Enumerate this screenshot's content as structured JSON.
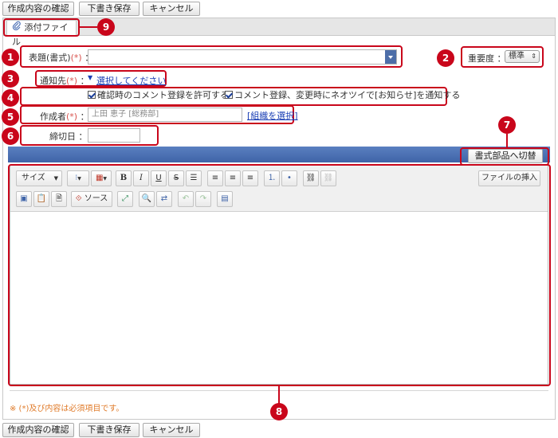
{
  "top_actions": {
    "confirm": "作成内容の確認",
    "draft": "下書き保存",
    "cancel": "キャンセル"
  },
  "tab": {
    "label": "添付ファイル"
  },
  "form": {
    "subject_label": "表題(書式)",
    "required_mark": "(*)",
    "colon": "：",
    "importance_label": "重要度",
    "importance_value": "標準",
    "notify_label": "通知先",
    "notify_link": "選択してください",
    "option1": "確認時のコメント登録を許可する",
    "option2": "コメント登録、変更時にネオツイで[お知らせ]を通知する",
    "author_label": "作成者",
    "author_value": "上田 恵子 [総務部]",
    "org_link": "[組織を選択]",
    "deadline_label": "締切日"
  },
  "format_switch": "書式部品へ切替",
  "editor": {
    "size_label": "サイズ",
    "source_label": "ソース",
    "insert_file": "ファイルの挿入"
  },
  "footer_note": "※ (*)及び内容は必須項目です。",
  "callouts": [
    "1",
    "2",
    "3",
    "4",
    "5",
    "6",
    "7",
    "8",
    "9"
  ],
  "colors": {
    "accent": "#c9061b",
    "bar": "#3f64a8",
    "link": "#1a3fb5"
  }
}
